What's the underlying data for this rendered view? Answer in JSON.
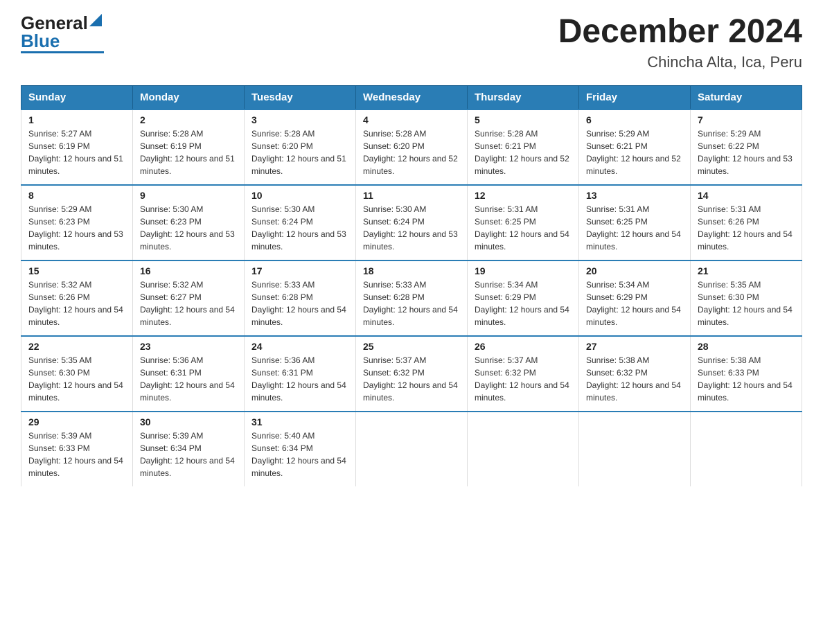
{
  "logo": {
    "general": "General",
    "blue": "Blue"
  },
  "title": "December 2024",
  "subtitle": "Chincha Alta, Ica, Peru",
  "days_of_week": [
    "Sunday",
    "Monday",
    "Tuesday",
    "Wednesday",
    "Thursday",
    "Friday",
    "Saturday"
  ],
  "weeks": [
    [
      {
        "day": "1",
        "sunrise": "5:27 AM",
        "sunset": "6:19 PM",
        "daylight": "12 hours and 51 minutes."
      },
      {
        "day": "2",
        "sunrise": "5:28 AM",
        "sunset": "6:19 PM",
        "daylight": "12 hours and 51 minutes."
      },
      {
        "day": "3",
        "sunrise": "5:28 AM",
        "sunset": "6:20 PM",
        "daylight": "12 hours and 51 minutes."
      },
      {
        "day": "4",
        "sunrise": "5:28 AM",
        "sunset": "6:20 PM",
        "daylight": "12 hours and 52 minutes."
      },
      {
        "day": "5",
        "sunrise": "5:28 AM",
        "sunset": "6:21 PM",
        "daylight": "12 hours and 52 minutes."
      },
      {
        "day": "6",
        "sunrise": "5:29 AM",
        "sunset": "6:21 PM",
        "daylight": "12 hours and 52 minutes."
      },
      {
        "day": "7",
        "sunrise": "5:29 AM",
        "sunset": "6:22 PM",
        "daylight": "12 hours and 53 minutes."
      }
    ],
    [
      {
        "day": "8",
        "sunrise": "5:29 AM",
        "sunset": "6:23 PM",
        "daylight": "12 hours and 53 minutes."
      },
      {
        "day": "9",
        "sunrise": "5:30 AM",
        "sunset": "6:23 PM",
        "daylight": "12 hours and 53 minutes."
      },
      {
        "day": "10",
        "sunrise": "5:30 AM",
        "sunset": "6:24 PM",
        "daylight": "12 hours and 53 minutes."
      },
      {
        "day": "11",
        "sunrise": "5:30 AM",
        "sunset": "6:24 PM",
        "daylight": "12 hours and 53 minutes."
      },
      {
        "day": "12",
        "sunrise": "5:31 AM",
        "sunset": "6:25 PM",
        "daylight": "12 hours and 54 minutes."
      },
      {
        "day": "13",
        "sunrise": "5:31 AM",
        "sunset": "6:25 PM",
        "daylight": "12 hours and 54 minutes."
      },
      {
        "day": "14",
        "sunrise": "5:31 AM",
        "sunset": "6:26 PM",
        "daylight": "12 hours and 54 minutes."
      }
    ],
    [
      {
        "day": "15",
        "sunrise": "5:32 AM",
        "sunset": "6:26 PM",
        "daylight": "12 hours and 54 minutes."
      },
      {
        "day": "16",
        "sunrise": "5:32 AM",
        "sunset": "6:27 PM",
        "daylight": "12 hours and 54 minutes."
      },
      {
        "day": "17",
        "sunrise": "5:33 AM",
        "sunset": "6:28 PM",
        "daylight": "12 hours and 54 minutes."
      },
      {
        "day": "18",
        "sunrise": "5:33 AM",
        "sunset": "6:28 PM",
        "daylight": "12 hours and 54 minutes."
      },
      {
        "day": "19",
        "sunrise": "5:34 AM",
        "sunset": "6:29 PM",
        "daylight": "12 hours and 54 minutes."
      },
      {
        "day": "20",
        "sunrise": "5:34 AM",
        "sunset": "6:29 PM",
        "daylight": "12 hours and 54 minutes."
      },
      {
        "day": "21",
        "sunrise": "5:35 AM",
        "sunset": "6:30 PM",
        "daylight": "12 hours and 54 minutes."
      }
    ],
    [
      {
        "day": "22",
        "sunrise": "5:35 AM",
        "sunset": "6:30 PM",
        "daylight": "12 hours and 54 minutes."
      },
      {
        "day": "23",
        "sunrise": "5:36 AM",
        "sunset": "6:31 PM",
        "daylight": "12 hours and 54 minutes."
      },
      {
        "day": "24",
        "sunrise": "5:36 AM",
        "sunset": "6:31 PM",
        "daylight": "12 hours and 54 minutes."
      },
      {
        "day": "25",
        "sunrise": "5:37 AM",
        "sunset": "6:32 PM",
        "daylight": "12 hours and 54 minutes."
      },
      {
        "day": "26",
        "sunrise": "5:37 AM",
        "sunset": "6:32 PM",
        "daylight": "12 hours and 54 minutes."
      },
      {
        "day": "27",
        "sunrise": "5:38 AM",
        "sunset": "6:32 PM",
        "daylight": "12 hours and 54 minutes."
      },
      {
        "day": "28",
        "sunrise": "5:38 AM",
        "sunset": "6:33 PM",
        "daylight": "12 hours and 54 minutes."
      }
    ],
    [
      {
        "day": "29",
        "sunrise": "5:39 AM",
        "sunset": "6:33 PM",
        "daylight": "12 hours and 54 minutes."
      },
      {
        "day": "30",
        "sunrise": "5:39 AM",
        "sunset": "6:34 PM",
        "daylight": "12 hours and 54 minutes."
      },
      {
        "day": "31",
        "sunrise": "5:40 AM",
        "sunset": "6:34 PM",
        "daylight": "12 hours and 54 minutes."
      },
      null,
      null,
      null,
      null
    ]
  ]
}
